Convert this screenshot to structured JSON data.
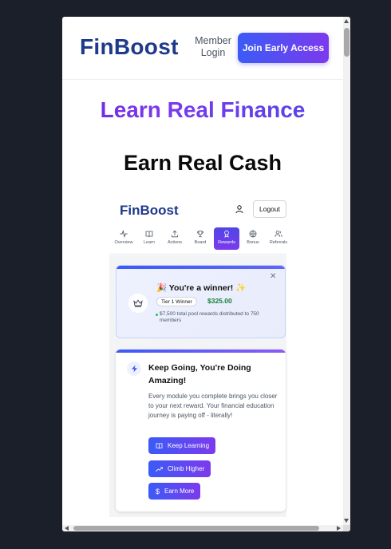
{
  "header": {
    "logo": "FinBoost",
    "member_login": "Member Login",
    "join_button": "Join Early Access"
  },
  "hero": {
    "line1": "Learn Real Finance",
    "line2": "Earn Real Cash"
  },
  "app_preview": {
    "logo": "FinBoost",
    "logout": "Logout",
    "tabs": [
      {
        "label": "Overview",
        "icon": "activity-icon"
      },
      {
        "label": "Learn",
        "icon": "book-icon"
      },
      {
        "label": "Actions",
        "icon": "upload-icon"
      },
      {
        "label": "Board",
        "icon": "trophy-icon"
      },
      {
        "label": "Rewards",
        "icon": "award-icon"
      },
      {
        "label": "Bonus",
        "icon": "globe-icon"
      },
      {
        "label": "Referrals",
        "icon": "users-icon"
      }
    ],
    "active_tab": "Rewards",
    "winner": {
      "title": "🎉 You're a winner! ✨",
      "tier": "Tier 1 Winner",
      "amount": "$325.00",
      "pool_text": "$7,500 total pool rewards distributed to 750 members"
    },
    "keep_going": {
      "title": "Keep Going, You're Doing Amazing!",
      "text": "Every module you complete brings you closer to your next reward. Your financial education journey is paying off - literally!",
      "buttons": [
        {
          "label": "Keep Learning",
          "icon": "book-icon"
        },
        {
          "label": "Climb Higher",
          "icon": "trending-up-icon"
        },
        {
          "label": "Earn More",
          "icon": "dollar-icon"
        }
      ]
    }
  },
  "colors": {
    "brand_navy": "#1e3a8a",
    "gradient_start": "#3b5bf6",
    "gradient_end": "#7c3aed",
    "amount_green": "#15803d",
    "page_background": "#1b1f2a"
  }
}
